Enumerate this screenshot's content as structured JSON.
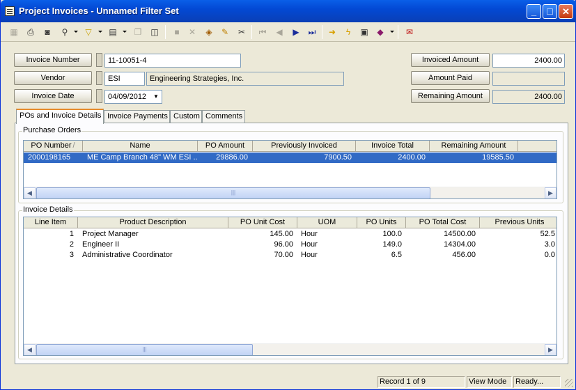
{
  "window": {
    "title": "Project Invoices - Unnamed Filter Set",
    "minimize": "_",
    "maximize": "□",
    "close": "✕"
  },
  "toolbar": {
    "icons": [
      "grid-icon",
      "print-icon",
      "print-preview-icon",
      "find-icon",
      "filter-icon",
      "view-icon",
      "copy-record-icon",
      "layout-icon",
      "save-icon",
      "delete-icon",
      "stamp-icon",
      "edit-icon",
      "cut-icon",
      "first-record-icon",
      "previous-record-icon",
      "next-record-icon",
      "last-record-icon",
      "jump-icon",
      "run-icon",
      "report-icon",
      "book-icon",
      "mail-icon"
    ]
  },
  "form": {
    "invoice_number_label": "Invoice Number",
    "invoice_number": "11-10051-4",
    "vendor_label": "Vendor",
    "vendor_code": "ESI",
    "vendor_name": "Engineering Strategies, Inc.",
    "invoice_date_label": "Invoice Date",
    "invoice_date": "04/09/2012",
    "invoiced_amount_label": "Invoiced Amount",
    "invoiced_amount": "2400.00",
    "amount_paid_label": "Amount Paid",
    "amount_paid": "",
    "remaining_amount_label": "Remaining Amount",
    "remaining_amount": "2400.00"
  },
  "tabs": [
    {
      "label": "POs and Invoice Details"
    },
    {
      "label": "Invoice Payments"
    },
    {
      "label": "Custom"
    },
    {
      "label": "Comments"
    }
  ],
  "purchase_orders": {
    "label": "Purchase Orders",
    "columns": [
      "PO Number",
      "Name",
      "PO Amount",
      "Previously Invoiced",
      "Invoice Total",
      "Remaining Amount"
    ],
    "sort_indicator": "/",
    "rows": [
      {
        "po_number": "2000198165",
        "name": "ME Camp Branch 48\" WM ESI ...",
        "po_amount": "29886.00",
        "previously_invoiced": "7900.50",
        "invoice_total": "2400.00",
        "remaining_amount": "19585.50"
      }
    ]
  },
  "invoice_details": {
    "label": "Invoice Details",
    "columns": [
      "Line Item",
      "Product Description",
      "PO Unit Cost",
      "UOM",
      "PO Units",
      "PO Total Cost",
      "Previous Units"
    ],
    "rows": [
      {
        "line_item": "1",
        "description": "Project Manager",
        "unit_cost": "145.00",
        "uom": "Hour",
        "units": "100.0",
        "total_cost": "14500.00",
        "previous_units": "52.5"
      },
      {
        "line_item": "2",
        "description": "Engineer II",
        "unit_cost": "96.00",
        "uom": "Hour",
        "units": "149.0",
        "total_cost": "14304.00",
        "previous_units": "3.0"
      },
      {
        "line_item": "3",
        "description": "Administrative Coordinator",
        "unit_cost": "70.00",
        "uom": "Hour",
        "units": "6.5",
        "total_cost": "456.00",
        "previous_units": "0.0"
      }
    ]
  },
  "status": {
    "record": "Record 1 of 9",
    "mode": "View Mode",
    "state": "Ready..."
  }
}
